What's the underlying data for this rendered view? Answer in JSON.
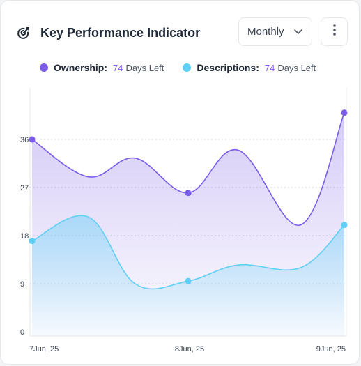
{
  "header": {
    "title": "Key Performance Indicator",
    "period_select": "Monthly"
  },
  "legend": [
    {
      "name": "Ownership:",
      "days": "74",
      "days_suffix": "Days Left",
      "color": "#7b5ce6"
    },
    {
      "name": "Descriptions:",
      "days": "74",
      "days_suffix": "Days Left",
      "color": "#5fcff5"
    }
  ],
  "colors": {
    "ownership": "#7b5ce6",
    "descriptions": "#5fcff5",
    "grid": "#d1d5db",
    "tick_text": "#374151"
  },
  "chart_data": {
    "type": "area",
    "x_tick_labels": [
      "7Jun, 25",
      "8Jun, 25",
      "9Jun, 25"
    ],
    "y_ticks": [
      0,
      9,
      18,
      27,
      36
    ],
    "ylim": [
      0,
      45
    ],
    "grid": true,
    "series": [
      {
        "name": "Ownership",
        "points": [
          [
            0,
            36
          ],
          [
            0.18,
            29
          ],
          [
            0.33,
            32.5
          ],
          [
            0.5,
            26
          ],
          [
            0.66,
            34
          ],
          [
            0.86,
            20
          ],
          [
            1,
            41
          ]
        ],
        "markers": [
          0,
          3,
          6
        ]
      },
      {
        "name": "Descriptions",
        "points": [
          [
            0,
            17
          ],
          [
            0.18,
            21.5
          ],
          [
            0.33,
            9
          ],
          [
            0.5,
            9.5
          ],
          [
            0.66,
            12.5
          ],
          [
            0.86,
            12
          ],
          [
            1,
            20
          ]
        ],
        "markers": [
          0,
          3,
          6
        ]
      }
    ]
  }
}
